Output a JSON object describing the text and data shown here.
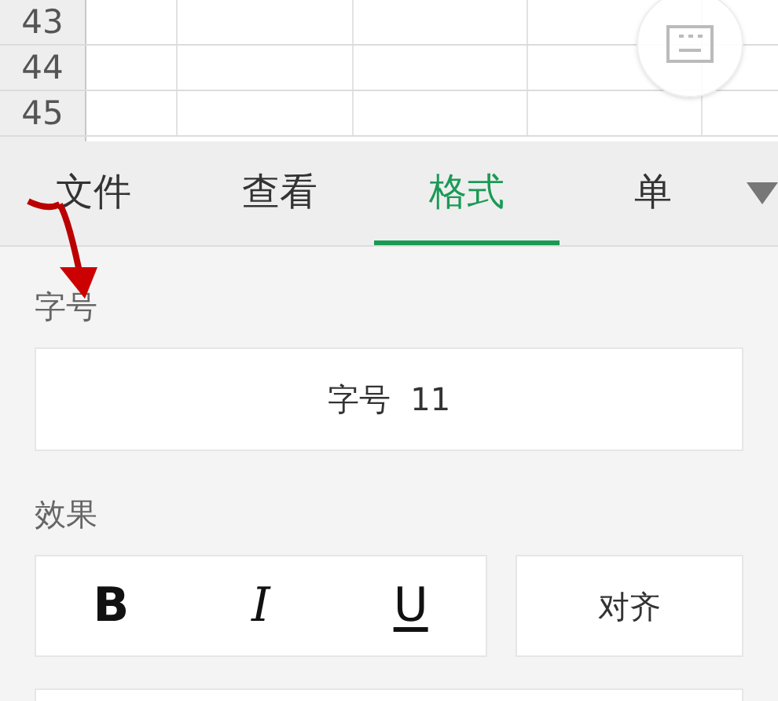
{
  "sheet": {
    "row_headers": [
      "43",
      "44",
      "45"
    ]
  },
  "tabs": [
    {
      "label": "文件",
      "selected": false
    },
    {
      "label": "查看",
      "selected": false
    },
    {
      "label": "格式",
      "selected": true
    },
    {
      "label": "单",
      "selected": false
    }
  ],
  "font_size": {
    "label": "字号",
    "value": "字号  11"
  },
  "effects": {
    "label": "效果",
    "styles": [
      {
        "kind": "bold",
        "label": "B"
      },
      {
        "kind": "italic",
        "label": "I"
      },
      {
        "kind": "underline",
        "label": "U"
      }
    ],
    "align": "对齐"
  }
}
